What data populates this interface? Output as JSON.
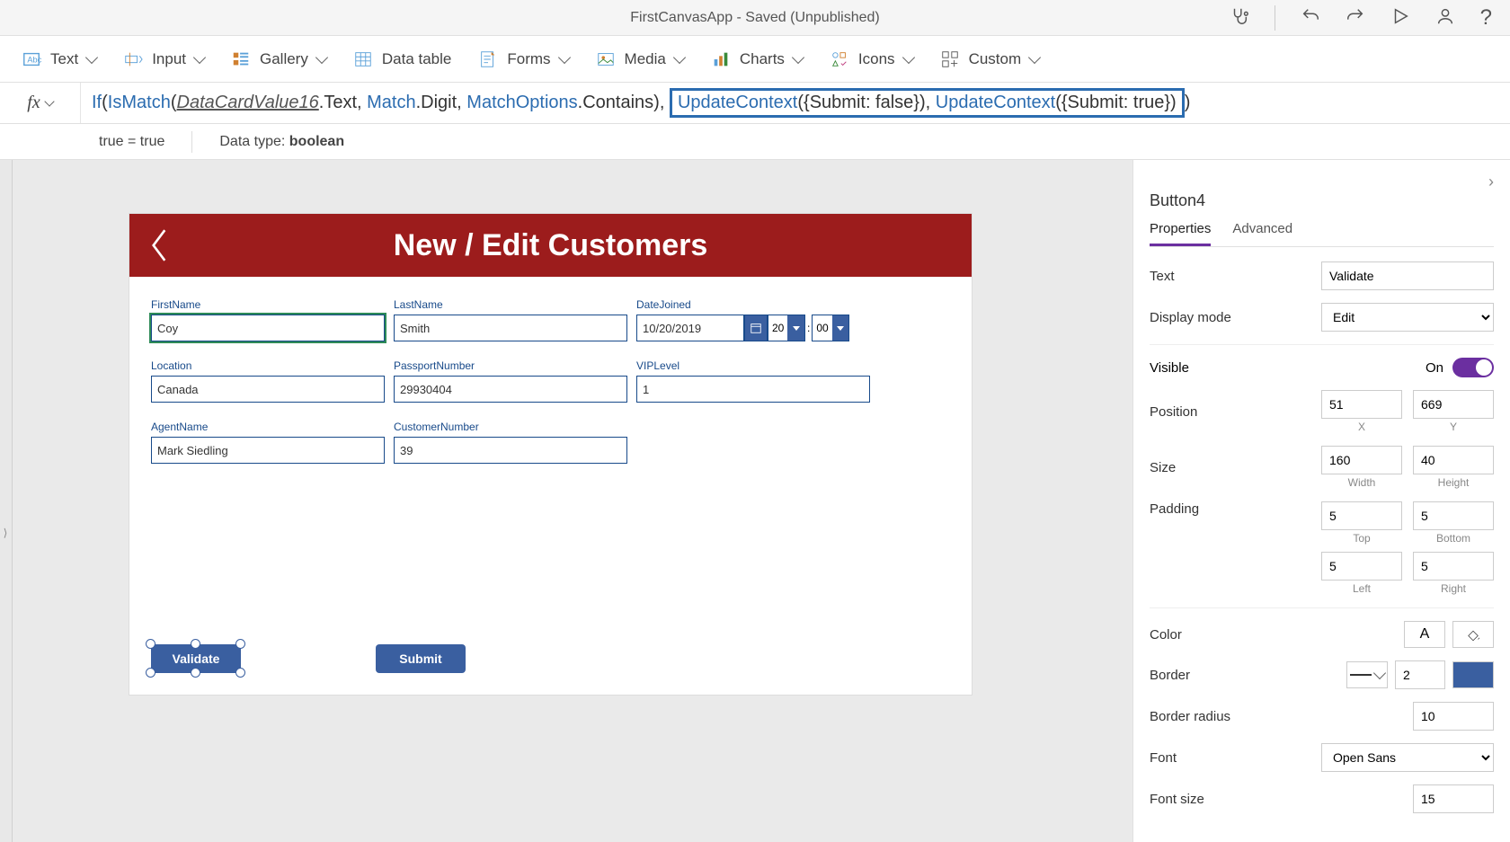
{
  "title": "FirstCanvasApp - Saved (Unpublished)",
  "ribbon": {
    "text": "Text",
    "input": "Input",
    "gallery": "Gallery",
    "datatable": "Data table",
    "forms": "Forms",
    "media": "Media",
    "charts": "Charts",
    "icons": "Icons",
    "custom": "Custom"
  },
  "formula": {
    "fx": "fx",
    "expr_prefix": "If(IsMatch(",
    "expr_id": "DataCardValue16",
    "expr_mid": ".Text, Match.Digit, MatchOptions.Contains), ",
    "expr_hl": "UpdateContext({Submit: false}), UpdateContext({Submit: true}))",
    "result_eq": "true  =  true",
    "datatype_label": "Data type:",
    "datatype_value": "boolean"
  },
  "canvas": {
    "title": "New / Edit Customers",
    "fields": {
      "firstname_label": "FirstName",
      "firstname": "Coy",
      "lastname_label": "LastName",
      "lastname": "Smith",
      "datejoined_label": "DateJoined",
      "datejoined": "10/20/2019",
      "hour": "20",
      "minute": "00",
      "location_label": "Location",
      "location": "Canada",
      "passport_label": "PassportNumber",
      "passport": "29930404",
      "vip_label": "VIPLevel",
      "vip": "1",
      "agent_label": "AgentName",
      "agent": "Mark Siedling",
      "custno_label": "CustomerNumber",
      "custno": "39"
    },
    "buttons": {
      "validate": "Validate",
      "submit": "Submit"
    }
  },
  "props": {
    "control_name": "Button4",
    "tab_properties": "Properties",
    "tab_advanced": "Advanced",
    "text_label": "Text",
    "text_value": "Validate",
    "displaymode_label": "Display mode",
    "displaymode_value": "Edit",
    "visible_label": "Visible",
    "visible_value": "On",
    "position_label": "Position",
    "pos_x": "51",
    "pos_y": "669",
    "x_label": "X",
    "y_label": "Y",
    "size_label": "Size",
    "size_w": "160",
    "size_h": "40",
    "w_label": "Width",
    "h_label": "Height",
    "padding_label": "Padding",
    "pad_top": "5",
    "pad_bottom": "5",
    "pad_left": "5",
    "pad_right": "5",
    "top_label": "Top",
    "bottom_label": "Bottom",
    "left_label": "Left",
    "right_label": "Right",
    "color_label": "Color",
    "border_label": "Border",
    "border_value": "2",
    "borderradius_label": "Border radius",
    "borderradius_value": "10",
    "font_label": "Font",
    "font_value": "Open Sans",
    "fontsize_label": "Font size",
    "fontsize_value": "15"
  }
}
